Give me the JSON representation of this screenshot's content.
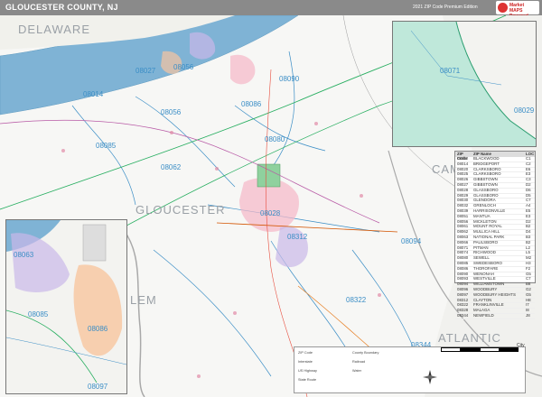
{
  "header": {
    "title": "GLOUCESTER COUNTY, NJ",
    "edition": "2021 ZIP Code Premium Edition",
    "logo_line1": "Market",
    "logo_line2": "MAPS",
    "logo_line3": "Powered"
  },
  "places": {
    "delaware": "DELAWARE",
    "gloucester": "GLOUCESTER",
    "camden": "CAM",
    "atlantic": "ATLANTIC",
    "salem": "LEM"
  },
  "zips": {
    "z08027": "08027",
    "z08056a": "08056",
    "z08090": "08090",
    "z08014": "08014",
    "z08056b": "08056",
    "z08086": "08086",
    "z08085": "08085",
    "z08080": "08080",
    "z08062": "08062",
    "z08028": "08028",
    "z08312": "08312",
    "z08094": "08094",
    "z08322": "08322",
    "z08344": "08344",
    "z08071": "08071",
    "z08029": "08029",
    "z08063": "08063",
    "z08086b": "08086",
    "z08085b": "08085",
    "z08097": "08097"
  },
  "legend": {
    "col1": "ZIP Code",
    "col2": "ZIP Name",
    "col3": "LOC",
    "rows": [
      [
        "08012",
        "BLACKWOOD",
        "C1"
      ],
      [
        "08014",
        "BRIDGEPORT",
        "C2"
      ],
      [
        "08020",
        "CLARKSBORO",
        "E6"
      ],
      [
        "08025",
        "CLARKSBORO",
        "E3"
      ],
      [
        "08026",
        "GIBBSTOWN",
        "C3"
      ],
      [
        "08027",
        "GIBBSTOWN",
        "D2"
      ],
      [
        "08028",
        "GLASSBORO",
        "D6"
      ],
      [
        "08029",
        "GLASSBORO",
        "D5"
      ],
      [
        "08030",
        "GLENDORA",
        "C7"
      ],
      [
        "08032",
        "GRENLOCH",
        "A4"
      ],
      [
        "08039",
        "HARRISONVILLE",
        "E5"
      ],
      [
        "08051",
        "MANTUA",
        "E3"
      ],
      [
        "08056",
        "MICKLETON",
        "D2"
      ],
      [
        "08061",
        "MOUNT ROYAL",
        "B2"
      ],
      [
        "08062",
        "MULLICA HILL",
        "D4"
      ],
      [
        "08063",
        "NATIONAL PARK",
        "B3"
      ],
      [
        "08066",
        "PAULSBORO",
        "B2"
      ],
      [
        "08071",
        "PITMAN",
        "L2"
      ],
      [
        "08074",
        "RICHWOOD",
        "L5"
      ],
      [
        "08080",
        "SEWELL",
        "M2"
      ],
      [
        "08085",
        "SWEDESBORO",
        "H3"
      ],
      [
        "08086",
        "THOROFARE",
        "F2"
      ],
      [
        "08090",
        "WENONAH",
        "G5"
      ],
      [
        "08093",
        "WESTVILLE",
        "C7"
      ],
      [
        "08094",
        "WILLIAMSTOWN",
        "B8"
      ],
      [
        "08096",
        "WOODBURY",
        "G2"
      ],
      [
        "08097",
        "WOODBURY HEIGHTS",
        "G5"
      ],
      [
        "08312",
        "CLAYTON",
        "H8"
      ],
      [
        "08322",
        "FRANKLINVILLE",
        "I7"
      ],
      [
        "08328",
        "MALAGA",
        "I8"
      ],
      [
        "08344",
        "NEWFIELD",
        "J8"
      ]
    ]
  },
  "key": {
    "scale": "0  1  2  3  4 mi",
    "city": "City",
    "items": [
      "ZIP Code",
      "Interstate",
      "US Highway",
      "State Route",
      "County Boundary",
      "Railroad",
      "Water"
    ]
  },
  "colors": {
    "water": "#7fb3d5",
    "zipline": "#3b8ec6",
    "park": "#8fd19e",
    "interstate": "#27ae60",
    "highway": "#d35400",
    "city_pink": "#f5b7c8",
    "city_purple": "#c9b8e8",
    "city_orange": "#f7c59f"
  }
}
